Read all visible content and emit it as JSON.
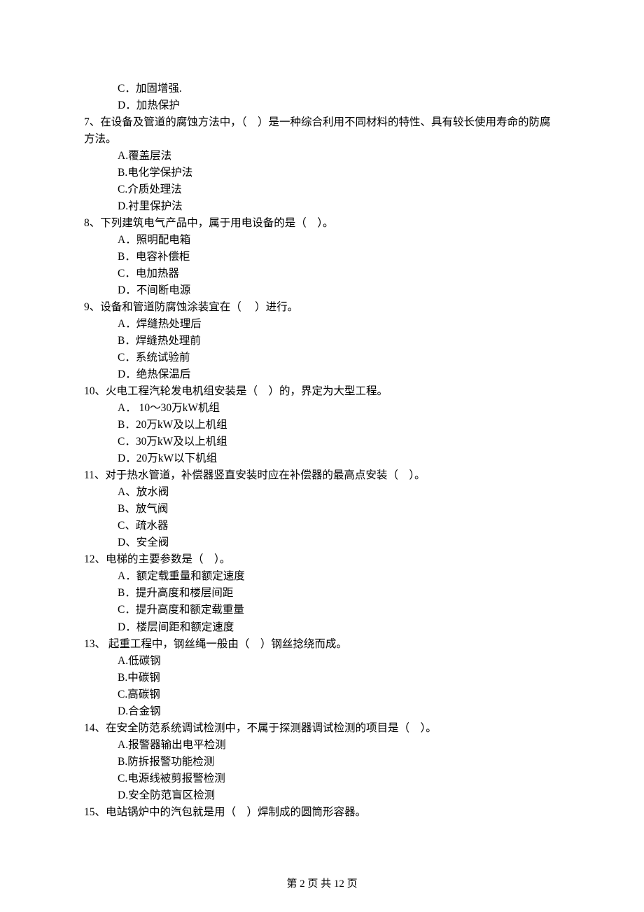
{
  "orphan_options": [
    "C．加固增强.",
    "D．加热保护"
  ],
  "questions": [
    {
      "stem": "7、在设备及管道的腐蚀方法中，（    ）是一种综合利用不同材料的特性、具有较长使用寿命的防腐方法。",
      "options": [
        "A.覆盖层法",
        "B.电化学保护法",
        "C.介质处理法",
        "D.衬里保护法"
      ]
    },
    {
      "stem": "8、下列建筑电气产品中，属于用电设备的是（    ）。",
      "options": [
        "A．照明配电箱",
        "B．电容补偿柜",
        "C．电加热器",
        "D．不间断电源"
      ]
    },
    {
      "stem": "9、设备和管道防腐蚀涂装宜在（     ）进行。",
      "options": [
        "A．焊缝热处理后",
        "B．焊缝热处理前",
        "C．系统试验前",
        "D．绝热保温后"
      ]
    },
    {
      "stem": "10、火电工程汽轮发电机组安装是（    ）的，界定为大型工程。",
      "options": [
        "A． 10～30万kW机组",
        "B．20万kW及以上机组",
        "C．30万kW及以上机组",
        "D．20万kW以下机组"
      ]
    },
    {
      "stem": "11、对于热水管道，补偿器竖直安装时应在补偿器的最高点安装（    ）。",
      "options": [
        "A、放水阀",
        "B、放气阀",
        "C、疏水器",
        "D、安全阀"
      ]
    },
    {
      "stem": "12、电梯的主要参数是（    ）。",
      "options": [
        "A．额定载重量和额定速度",
        "B．提升高度和楼层间距",
        "C．提升高度和额定载重量",
        "D．楼层间距和额定速度"
      ]
    },
    {
      "stem": "13、 起重工程中，钢丝绳一般由（    ）钢丝捻绕而成。",
      "options": [
        "A.低碳钢",
        "B.中碳钢",
        "C.高碳钢",
        "D.合金钢"
      ]
    },
    {
      "stem": "14、在安全防范系统调试检测中，不属于探测器调试检测的项目是（    ）。",
      "options": [
        "A.报警器输出电平检测",
        "B.防拆报警功能检测",
        "C.电源线被剪报警检测",
        "D.安全防范盲区检测"
      ]
    },
    {
      "stem": "15、电站锅炉中的汽包就是用（    ）焊制成的圆筒形容器。",
      "options": []
    }
  ],
  "footer": "第 2 页 共 12 页"
}
